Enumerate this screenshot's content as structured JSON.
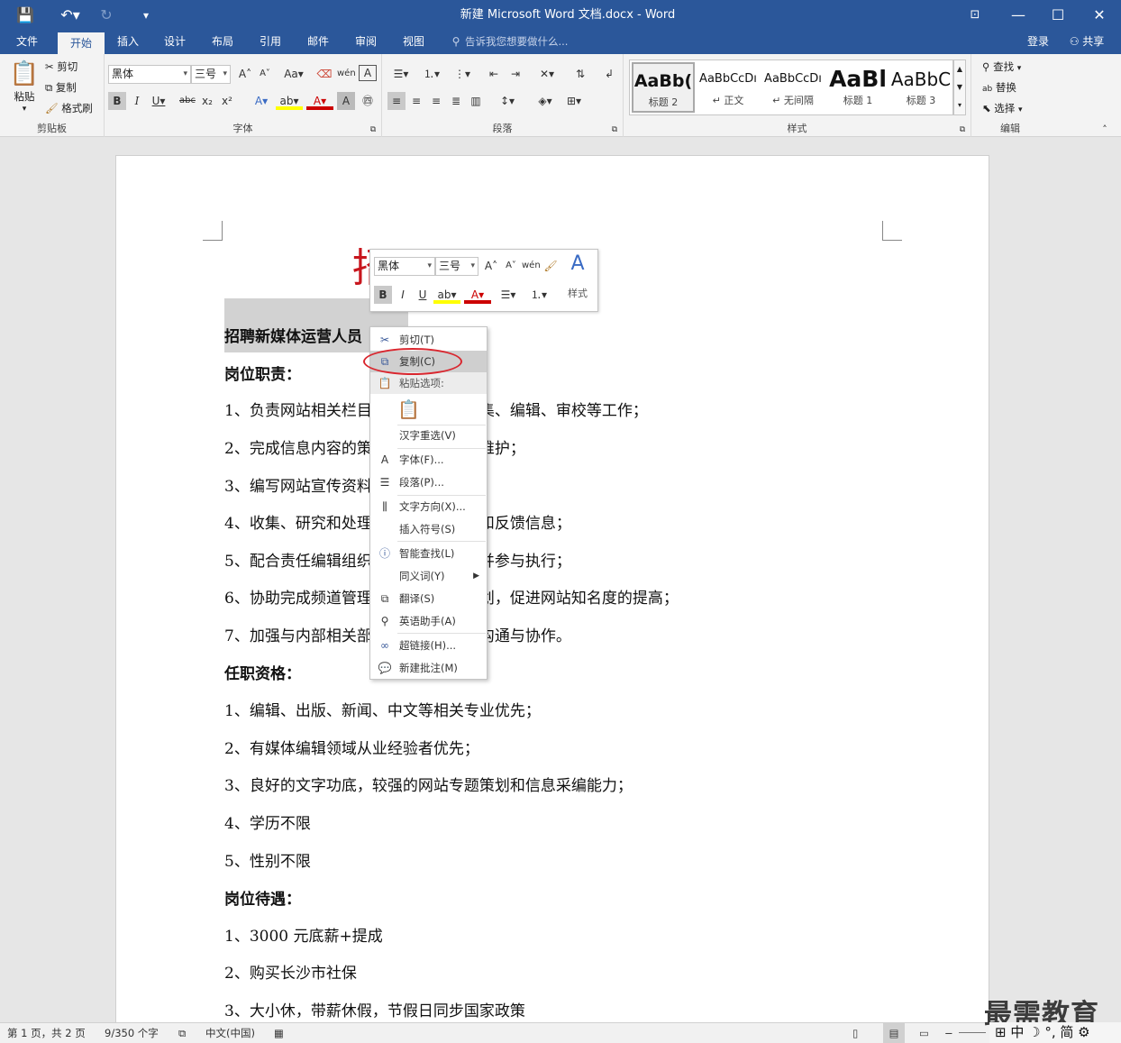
{
  "title_bar": {
    "window_title": "新建 Microsoft Word 文档.docx - Word"
  },
  "tabs": [
    {
      "label": "文件",
      "active": false
    },
    {
      "label": "开始",
      "active": true
    },
    {
      "label": "插入",
      "active": false
    },
    {
      "label": "设计",
      "active": false
    },
    {
      "label": "布局",
      "active": false
    },
    {
      "label": "引用",
      "active": false
    },
    {
      "label": "邮件",
      "active": false
    },
    {
      "label": "审阅",
      "active": false
    },
    {
      "label": "视图",
      "active": false
    }
  ],
  "tell_me": "告诉我您想要做什么...",
  "signin": "登录",
  "share": "共享",
  "ribbon": {
    "clipboard": {
      "label": "剪贴板",
      "paste": "粘贴",
      "cut": "剪切",
      "copy": "复制",
      "format_painter": "格式刷"
    },
    "font": {
      "label": "字体",
      "font_name": "黑体",
      "font_size": "三号"
    },
    "paragraph": {
      "label": "段落"
    },
    "styles": {
      "label": "样式",
      "items": [
        {
          "preview": "AaBb(",
          "name": "标题 2"
        },
        {
          "preview": "AaBbCcDı",
          "name": "↵ 正文"
        },
        {
          "preview": "AaBbCcDı",
          "name": "↵ 无间隔"
        },
        {
          "preview": "AaBl",
          "name": "标题 1"
        },
        {
          "preview": "AaBbC",
          "name": "标题 3"
        }
      ]
    },
    "editing": {
      "label": "编辑",
      "find": "查找",
      "replace": "替换",
      "select": "选择"
    }
  },
  "document": {
    "big_red_char": "招",
    "lines": [
      {
        "text": "招聘新媒体运营人员",
        "bold": true
      },
      {
        "text": "岗位职责：",
        "bold": true
      },
      {
        "text": "1、负责网站相关栏目、频道的信息搜集、编辑、审校等工作；",
        "bold": false
      },
      {
        "text": "2、完成信息内容的策划和日常更新与维护；",
        "bold": false
      },
      {
        "text": "3、编写网站宣传资料及相关产品资料；",
        "bold": false
      },
      {
        "text": "4、收集、研究和处理网络读者的意见和反馈信息；",
        "bold": false
      },
      {
        "text": "5、配合责任编辑组织策划相关活动，并参与执行；",
        "bold": false
      },
      {
        "text": "6、协助完成频道管理、运营及推广规划，促进网站知名度的提高；",
        "bold": false
      },
      {
        "text": "7、加强与内部相关部门和外部单位的沟通与协作。",
        "bold": false
      },
      {
        "text": "任职资格：",
        "bold": true
      },
      {
        "text": "1、编辑、出版、新闻、中文等相关专业优先；",
        "bold": false
      },
      {
        "text": "2、有媒体编辑领域从业经验者优先；",
        "bold": false
      },
      {
        "text": "3、良好的文字功底，较强的网站专题策划和信息采编能力；",
        "bold": false
      },
      {
        "text": "4、学历不限",
        "bold": false
      },
      {
        "text": "5、性别不限",
        "bold": false
      },
      {
        "text": "岗位待遇：",
        "bold": true
      },
      {
        "text": "1、3000 元底薪+提成",
        "bold": false
      },
      {
        "text": "2、购买长沙市社保",
        "bold": false
      },
      {
        "text": "3、大小休，带薪休假，节假日同步国家政策",
        "bold": false
      }
    ]
  },
  "mini_toolbar": {
    "font_name": "黑体",
    "font_size": "三号",
    "styles_label": "样式"
  },
  "context_menu": {
    "items": [
      {
        "label": "剪切(T)",
        "icon": "scissors-icon"
      },
      {
        "label": "复制(C)",
        "icon": "copy-icon"
      },
      {
        "label": "粘贴选项:",
        "icon": "paste-icon"
      },
      {
        "label": "",
        "icon": "clipboard-icon"
      },
      {
        "label": "汉字重选(V)",
        "icon": ""
      },
      {
        "label": "字体(F)...",
        "icon": "font-icon"
      },
      {
        "label": "段落(P)...",
        "icon": "paragraph-icon"
      },
      {
        "label": "文字方向(X)...",
        "icon": "text-direction-icon"
      },
      {
        "label": "插入符号(S)",
        "icon": ""
      },
      {
        "label": "智能查找(L)",
        "icon": "smart-lookup-icon"
      },
      {
        "label": "同义词(Y)",
        "icon": ""
      },
      {
        "label": "翻译(S)",
        "icon": "translate-icon"
      },
      {
        "label": "英语助手(A)",
        "icon": "english-assistant-icon"
      },
      {
        "label": "超链接(H)...",
        "icon": "hyperlink-icon"
      },
      {
        "label": "新建批注(M)",
        "icon": "new-comment-icon"
      }
    ]
  },
  "status_bar": {
    "page": "第 1 页，共 2 页",
    "words": "9/350 个字",
    "language": "中文(中国)"
  },
  "watermark": "最需教育",
  "ime": "中 ☽ °, 简"
}
